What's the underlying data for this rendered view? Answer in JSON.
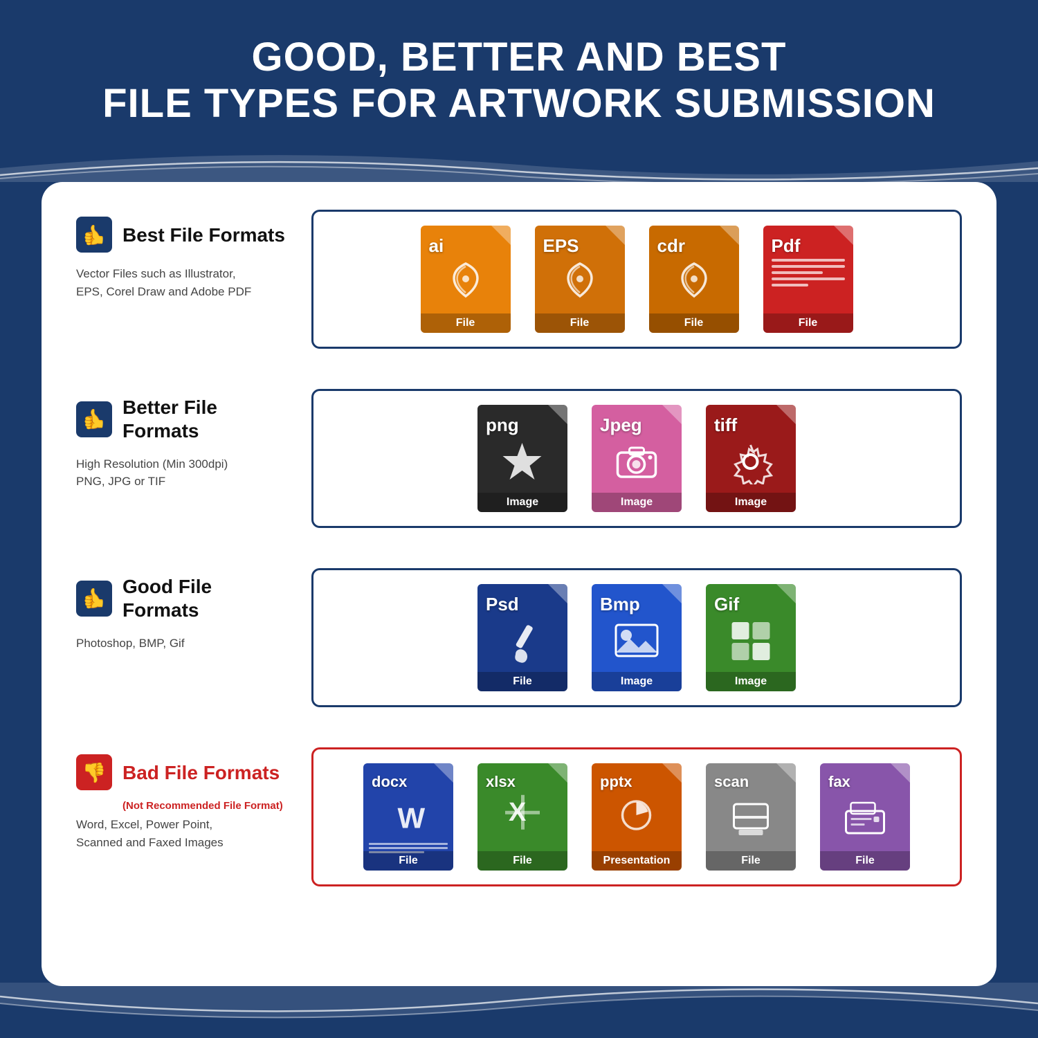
{
  "header": {
    "line1": "GOOD, BETTER AND BEST",
    "line2": "FILE TYPES FOR ARTWORK SUBMISSION"
  },
  "sections": [
    {
      "id": "best",
      "rating": "best",
      "thumb": "up",
      "title": "Best File Formats",
      "subtitle": null,
      "desc": "Vector Files such as Illustrator,\nEPS, Corel Draw and Adobe PDF",
      "border_color": "#1a3a6b",
      "files": [
        {
          "ext": "ai",
          "label": "File",
          "color": "#e8820a",
          "icon": "vector"
        },
        {
          "ext": "EPS",
          "label": "File",
          "color": "#d07008",
          "icon": "vector"
        },
        {
          "ext": "cdr",
          "label": "File",
          "color": "#d07008",
          "icon": "vector"
        },
        {
          "ext": "Pdf",
          "label": "File",
          "color": "#cc2222",
          "icon": "doc"
        }
      ]
    },
    {
      "id": "better",
      "rating": "better",
      "thumb": "up",
      "title": "Better File Formats",
      "subtitle": null,
      "desc": "High Resolution (Min 300dpi)\nPNG, JPG or TIF",
      "border_color": "#1a3a6b",
      "files": [
        {
          "ext": "png",
          "label": "Image",
          "color": "#2a2a2a",
          "icon": "star"
        },
        {
          "ext": "Jpeg",
          "label": "Image",
          "color": "#d45fa0",
          "icon": "camera"
        },
        {
          "ext": "tiff",
          "label": "Image",
          "color": "#9a1a1a",
          "icon": "gear"
        }
      ]
    },
    {
      "id": "good",
      "rating": "good",
      "thumb": "up",
      "title": "Good File Formats",
      "subtitle": null,
      "desc": "Photoshop, BMP, Gif",
      "border_color": "#1a3a6b",
      "files": [
        {
          "ext": "Psd",
          "label": "File",
          "color": "#1a3a8a",
          "icon": "brush"
        },
        {
          "ext": "Bmp",
          "label": "Image",
          "color": "#2255cc",
          "icon": "landscape"
        },
        {
          "ext": "Gif",
          "label": "Image",
          "color": "#3a8a2a",
          "icon": "grid"
        }
      ]
    },
    {
      "id": "bad",
      "rating": "bad",
      "thumb": "down",
      "title": "Bad File Formats",
      "subtitle": "(Not Recommended File Format)",
      "desc": "Word, Excel, Power Point,\nScanned and Faxed Images",
      "border_color": "#cc2222",
      "files": [
        {
          "ext": "docx",
          "label": "File",
          "color": "#2244aa",
          "icon": "word"
        },
        {
          "ext": "xlsx",
          "label": "File",
          "color": "#3a8a2a",
          "icon": "excel"
        },
        {
          "ext": "pptx",
          "label": "Presentation",
          "color": "#cc5500",
          "icon": "ppt"
        },
        {
          "ext": "scan",
          "label": "File",
          "color": "#888888",
          "icon": "scan"
        },
        {
          "ext": "fax",
          "label": "File",
          "color": "#8855aa",
          "icon": "fax"
        }
      ]
    }
  ],
  "colors": {
    "background": "#1a3a6b",
    "card_bg": "#ffffff",
    "accent_blue": "#1a3a6b",
    "accent_red": "#cc2222"
  }
}
